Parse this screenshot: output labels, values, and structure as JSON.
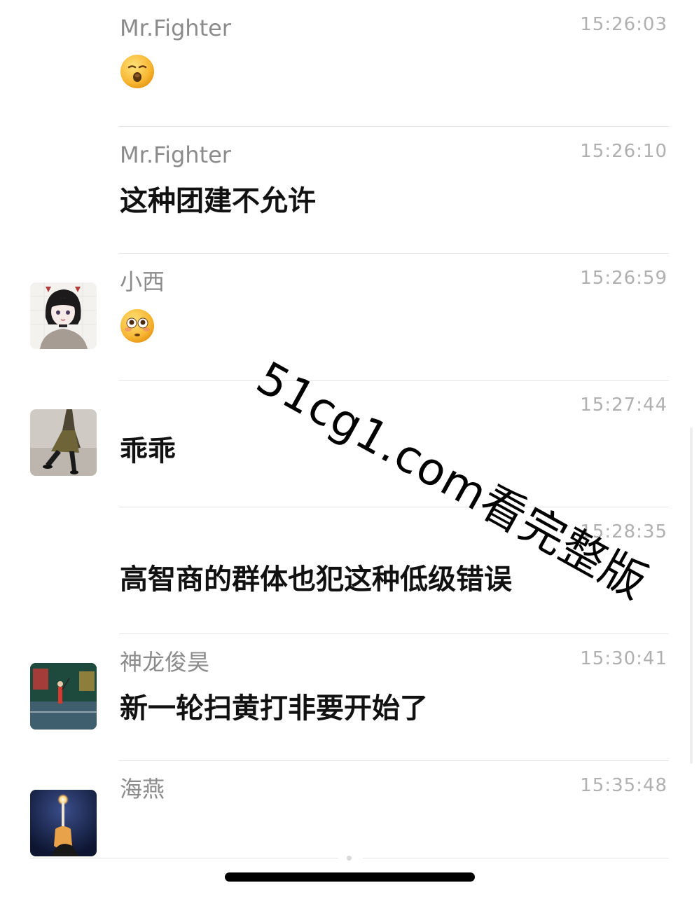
{
  "messages": [
    {
      "sender": "Mr.Fighter",
      "time": "15:26:03",
      "text": "",
      "emoji": "kissing-face-emoji",
      "avatar": "none"
    },
    {
      "sender": "Mr.Fighter",
      "time": "15:26:10",
      "text": "这种团建不允许",
      "avatar": "none"
    },
    {
      "sender": "小西",
      "time": "15:26:59",
      "text": "",
      "emoji": "flushed-face-emoji",
      "avatar": "anime-girl-avatar"
    },
    {
      "sender": "",
      "time": "15:27:44",
      "text": "乖乖",
      "avatar": "street-photo-avatar"
    },
    {
      "sender": "",
      "time": "15:28:35",
      "text": "高智商的群体也犯这种低级错误",
      "avatar": "none"
    },
    {
      "sender": "神龙俊昊",
      "time": "15:30:41",
      "text": "新一轮扫黄打非要开始了",
      "avatar": "tennis-court-avatar"
    },
    {
      "sender": "海燕",
      "time": "15:35:48",
      "text": "",
      "avatar": "candle-avatar"
    }
  ],
  "watermark": "51cg1.com看完整版",
  "colors": {
    "background": "#ffffff",
    "sender_text": "#8b8b8b",
    "time_text": "#b0b0b0",
    "message_text": "#111111",
    "divider": "#e3e3e3"
  }
}
